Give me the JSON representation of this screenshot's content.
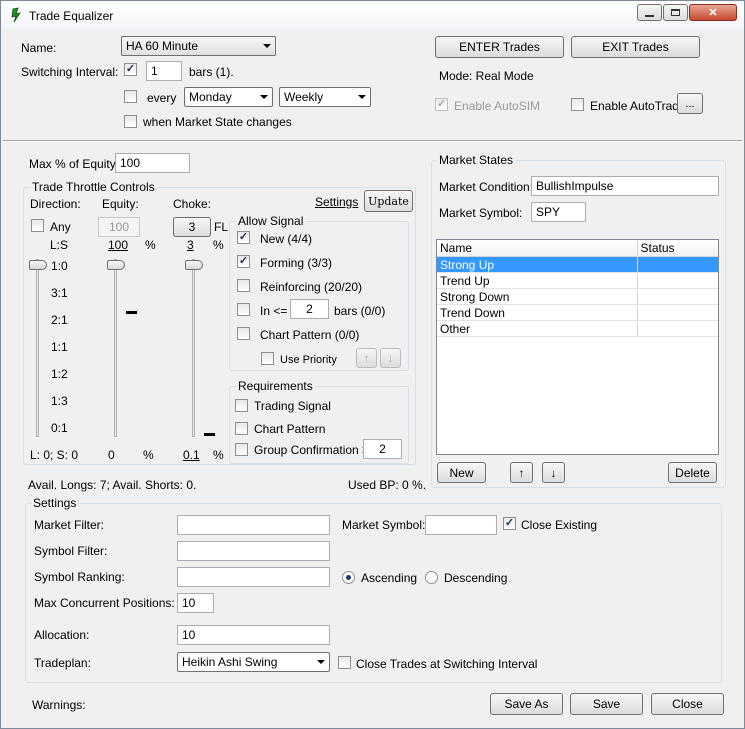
{
  "window": {
    "title": "Trade Equalizer",
    "minimize_glyph": "—",
    "maximize_glyph": "□",
    "close_glyph": "✕"
  },
  "top": {
    "name_label": "Name:",
    "name_value": "HA 60 Minute",
    "switching_label": "Switching Interval:",
    "switching_checked": true,
    "switching_value": "1",
    "bars_label": "bars (1).",
    "every_label": "every",
    "every_checked": false,
    "day_value": "Monday",
    "freq_value": "Weekly",
    "market_state_label": "when Market State changes",
    "market_state_checked": false,
    "enter_button": "ENTER Trades",
    "exit_button": "EXIT Trades",
    "mode_text": "Mode: Real Mode",
    "autosim_label": "Enable AutoSIM",
    "autosim_checked": true,
    "autotrade_label": "Enable AutoTrade",
    "autotrade_checked": false,
    "ellipsis_button": "..."
  },
  "throttle": {
    "max_equity_label": "Max % of Equity:",
    "max_equity_value": "100",
    "group_title": "Trade Throttle Controls",
    "direction_label": "Direction:",
    "equity_label": "Equity:",
    "choke_label": "Choke:",
    "settings_link": "Settings",
    "update_button": "Update",
    "any_label": "Any",
    "any_checked": false,
    "equity_box": "100",
    "choke_button": "3",
    "fl_label": "FL",
    "ls_label": "L:S",
    "equity_pct_value": "100",
    "pct_symbol": "%",
    "choke_value": "3",
    "ratios": [
      "1:0",
      "3:1",
      "2:1",
      "1:1",
      "1:2",
      "1:3",
      "0:1"
    ],
    "bottom_ls": "L: 0; S: 0",
    "bottom_equity": "0",
    "bottom_choke": "0.1",
    "avail_text": "Avail. Longs: 7; Avail. Shorts: 0.",
    "used_bp_text": "Used BP: 0 %."
  },
  "allow_signal": {
    "title": "Allow Signal",
    "new_label": "New (4/4)",
    "new_checked": true,
    "forming_label": "Forming (3/3)",
    "forming_checked": true,
    "reinforcing_label": "Reinforcing (20/20)",
    "reinforcing_checked": false,
    "in_label": "In <=",
    "in_checked": false,
    "in_value": "2",
    "in_suffix": "bars (0/0)",
    "chart_pattern_label": "Chart Pattern (0/0)",
    "chart_pattern_checked": false,
    "use_priority_label": "Use Priority",
    "use_priority_checked": false,
    "up_glyph": "↑",
    "down_glyph": "↓"
  },
  "requirements": {
    "title": "Requirements",
    "trading_signal_label": "Trading Signal",
    "chart_pattern_label": "Chart Pattern",
    "group_conf_label": "Group Confirmation >",
    "group_conf_value": "2"
  },
  "market_states": {
    "title": "Market States",
    "condition_label": "Market Condition:",
    "condition_value": "BullishImpulse",
    "symbol_label": "Market Symbol:",
    "symbol_value": "SPY",
    "columns": [
      "Name",
      "Status"
    ],
    "rows": [
      {
        "name": "Strong Up",
        "status": "",
        "selected": true
      },
      {
        "name": "Trend Up",
        "status": "",
        "selected": false
      },
      {
        "name": "Strong Down",
        "status": "",
        "selected": false
      },
      {
        "name": "Trend Down",
        "status": "",
        "selected": false
      },
      {
        "name": "Other",
        "status": "",
        "selected": false
      }
    ],
    "new_button": "New",
    "up_glyph": "↑",
    "down_glyph": "↓",
    "delete_button": "Delete",
    "selection_color": "#3399ff"
  },
  "settings": {
    "title": "Settings",
    "market_filter_label": "Market Filter:",
    "market_filter_value": "",
    "market_symbol_label": "Market Symbol:",
    "market_symbol_value": "",
    "close_existing_label": "Close Existing",
    "close_existing_checked": true,
    "symbol_filter_label": "Symbol Filter:",
    "symbol_filter_value": "",
    "symbol_ranking_label": "Symbol Ranking:",
    "symbol_ranking_value": "",
    "ascending_label": "Ascending",
    "descending_label": "Descending",
    "ranking_order": "Ascending",
    "max_positions_label": "Max Concurrent Positions:",
    "max_positions_value": "10",
    "allocation_label": "Allocation:",
    "allocation_value": "10",
    "tradeplan_label": "Tradeplan:",
    "tradeplan_value": "Heikin Ashi Swing",
    "close_trades_label": "Close Trades at Switching Interval",
    "close_trades_checked": false
  },
  "footer": {
    "warnings_label": "Warnings:",
    "save_as_button": "Save As",
    "save_button": "Save",
    "close_button": "Close"
  }
}
